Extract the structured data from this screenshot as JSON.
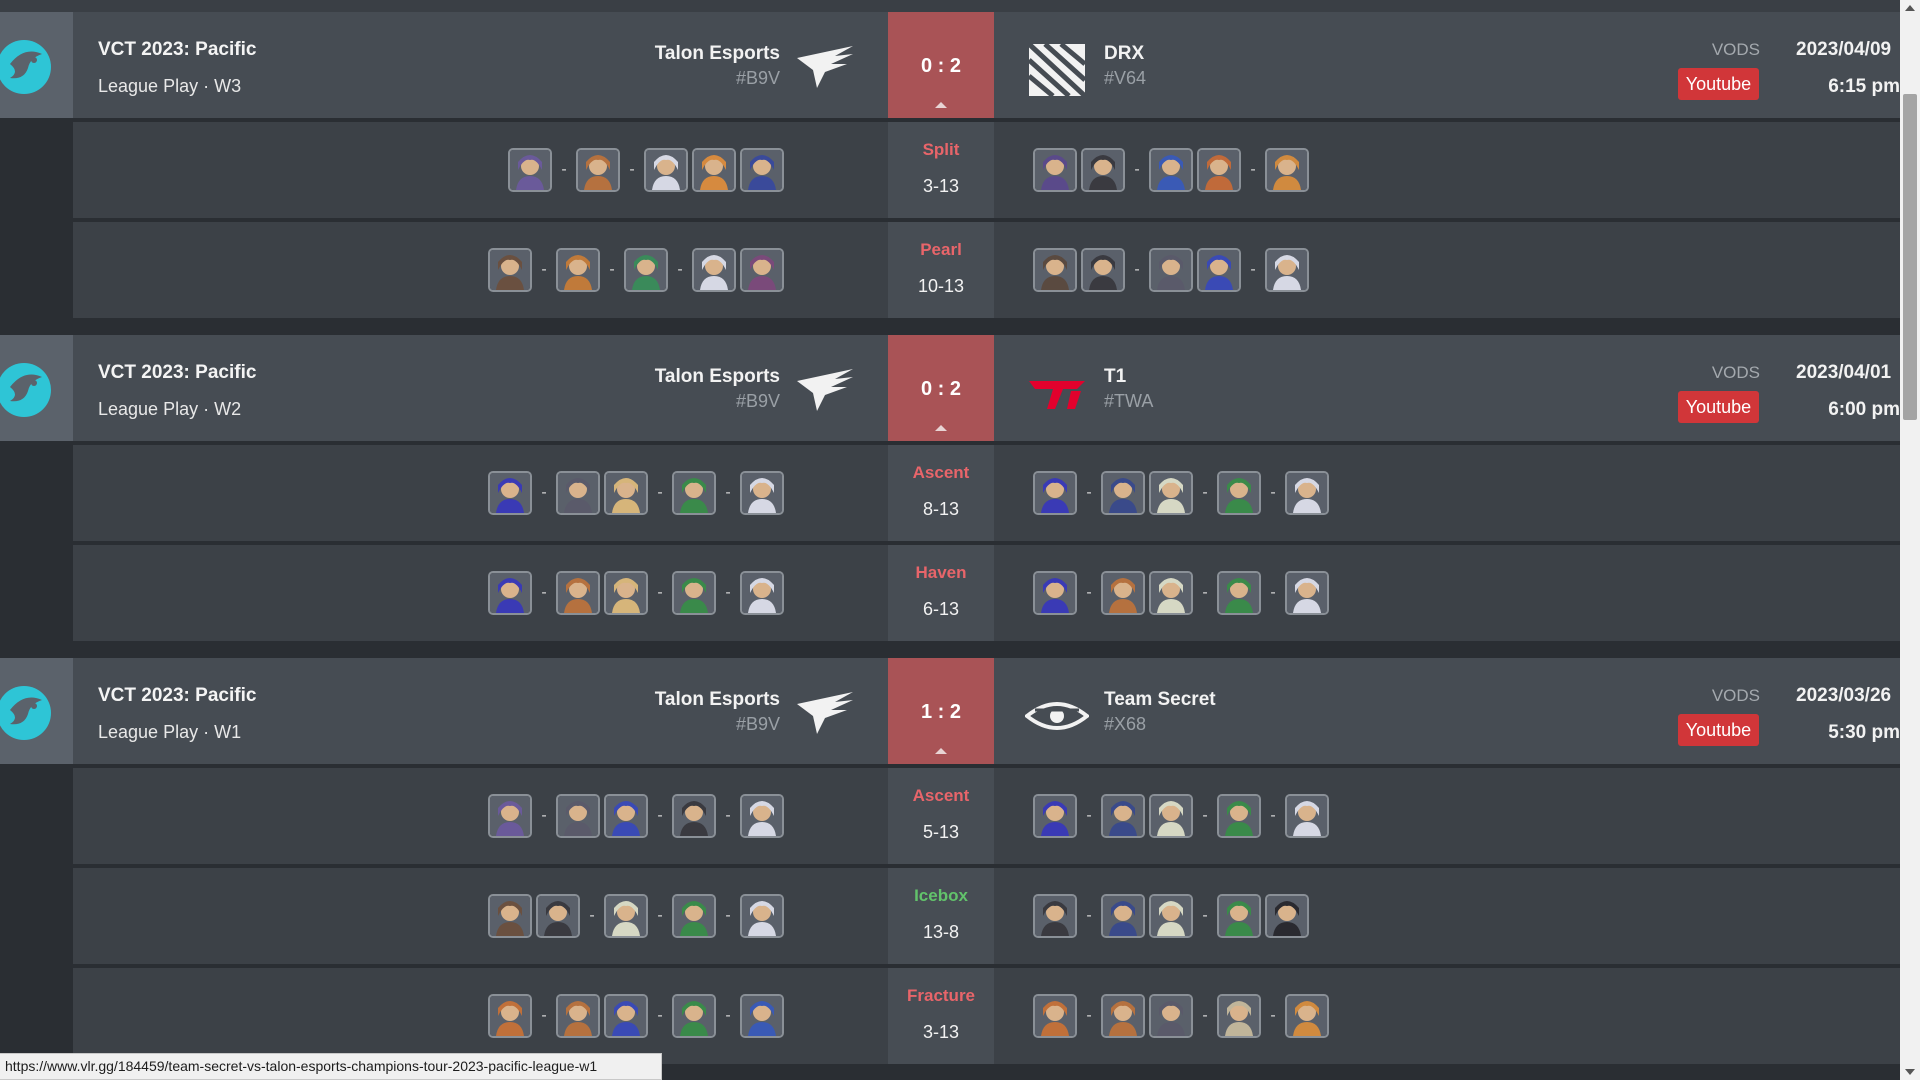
{
  "colors": {
    "page_bg": "#2a2e33",
    "header_bg": "#464c53",
    "map_row_bg": "#3c4147",
    "score_box": "#a95356",
    "map_loss": "#e8656a",
    "map_win": "#62c36b",
    "youtube_red": "#d13639",
    "event_accent": "#2ec5d6"
  },
  "matches": [
    {
      "event": "VCT 2023: Pacific",
      "stage": "League Play · W3",
      "team1": {
        "name": "Talon Esports",
        "tag": "#B9V",
        "logo": "talon-logo-icon"
      },
      "team2": {
        "name": "DRX",
        "tag": "#V64",
        "logo": "drx-logo-icon"
      },
      "score": "0 : 2",
      "vods_label": "VODS",
      "vod_link": "Youtube",
      "date": "2023/04/09",
      "time": "6:15 pm",
      "maps": [
        {
          "name": "Split",
          "score": "3-13",
          "result": "loss",
          "left_comp": [
            [
              "#6a5a9a"
            ],
            [
              "#b5713f"
            ],
            [
              "#d6d8e4",
              "#d68a3f",
              "#3a4a9a"
            ]
          ],
          "right_comp": [
            [
              "#5a4a8a",
              "#3a3a40"
            ],
            [
              "#3a5ab5",
              "#c06a3a"
            ],
            [
              "#d08a3f"
            ]
          ]
        },
        {
          "name": "Pearl",
          "score": "10-13",
          "result": "loss",
          "left_comp": [
            [
              "#6a5040"
            ],
            [
              "#c07a3a"
            ],
            [
              "#3a8a5a"
            ],
            [
              "#d6d8e4",
              "#7a4a7a"
            ]
          ],
          "right_comp": [
            [
              "#5a4a40",
              "#3a3a40"
            ],
            [
              "#5a5a6a",
              "#3a4ab5"
            ],
            [
              "#d6d8e4"
            ]
          ]
        }
      ]
    },
    {
      "event": "VCT 2023: Pacific",
      "stage": "League Play · W2",
      "team1": {
        "name": "Talon Esports",
        "tag": "#B9V",
        "logo": "talon-logo-icon"
      },
      "team2": {
        "name": "T1",
        "tag": "#TWA",
        "logo": "t1-logo-icon"
      },
      "score": "0 : 2",
      "vods_label": "VODS",
      "vod_link": "Youtube",
      "date": "2023/04/01",
      "time": "6:00 pm",
      "maps": [
        {
          "name": "Ascent",
          "score": "8-13",
          "result": "loss",
          "left_comp": [
            [
              "#3a3ab5"
            ],
            [
              "#5a5a6a",
              "#d6b57a"
            ],
            [
              "#3a8a4a"
            ],
            [
              "#d6d8e4"
            ]
          ],
          "right_comp": [
            [
              "#3a3ab5"
            ],
            [
              "#3a4a8a",
              "#d6d8c4"
            ],
            [
              "#3a8a4a"
            ],
            [
              "#d6d8e4"
            ]
          ]
        },
        {
          "name": "Haven",
          "score": "6-13",
          "result": "loss",
          "left_comp": [
            [
              "#3a3ab5"
            ],
            [
              "#b5713f",
              "#d6b57a"
            ],
            [
              "#3a8a4a"
            ],
            [
              "#d6d8e4"
            ]
          ],
          "right_comp": [
            [
              "#3a3ab5"
            ],
            [
              "#b5713f",
              "#d6d8c4"
            ],
            [
              "#3a8a4a"
            ],
            [
              "#d6d8e4"
            ]
          ]
        }
      ]
    },
    {
      "event": "VCT 2023: Pacific",
      "stage": "League Play · W1",
      "team1": {
        "name": "Talon Esports",
        "tag": "#B9V",
        "logo": "talon-logo-icon"
      },
      "team2": {
        "name": "Team Secret",
        "tag": "#X68",
        "logo": "team-secret-logo-icon"
      },
      "score": "1 : 2",
      "vods_label": "VODS",
      "vod_link": "Youtube",
      "date": "2023/03/26",
      "time": "5:30 pm",
      "maps": [
        {
          "name": "Ascent",
          "score": "5-13",
          "result": "loss",
          "left_comp": [
            [
              "#6a5a9a"
            ],
            [
              "#5a5a6a",
              "#3a4ab5"
            ],
            [
              "#3a3a40"
            ],
            [
              "#d6d8e4"
            ]
          ],
          "right_comp": [
            [
              "#3a3ab5"
            ],
            [
              "#3a4a8a",
              "#d6d8c4"
            ],
            [
              "#3a8a4a"
            ],
            [
              "#d6d8e4"
            ]
          ]
        },
        {
          "name": "Icebox",
          "score": "13-8",
          "result": "win",
          "left_comp": [
            [
              "#6a5040",
              "#3a3a40"
            ],
            [
              "#d6d8c4"
            ],
            [
              "#3a8a4a"
            ],
            [
              "#d6d8e4"
            ]
          ],
          "right_comp": [
            [
              "#3a3a40"
            ],
            [
              "#3a4a8a",
              "#d6d8c4"
            ],
            [
              "#3a8a4a",
              "#2a2a30"
            ]
          ]
        },
        {
          "name": "Fracture",
          "score": "3-13",
          "result": "loss",
          "left_comp": [
            [
              "#c0703a"
            ],
            [
              "#b5713f",
              "#3a4ab5"
            ],
            [
              "#3a8a4a"
            ],
            [
              "#3a5ab5"
            ]
          ],
          "right_comp": [
            [
              "#c0703a"
            ],
            [
              "#b5713f",
              "#5a5a6a"
            ],
            [
              "#c0b59a"
            ],
            [
              "#d08a3f"
            ]
          ]
        }
      ]
    }
  ],
  "status_bar": {
    "url": "https://www.vlr.gg/184459/team-secret-vs-talon-esports-champions-tour-2023-pacific-league-w1"
  }
}
